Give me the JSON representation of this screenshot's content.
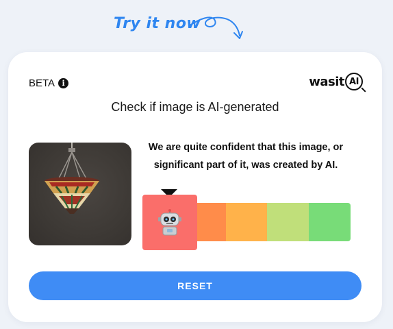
{
  "banner": {
    "text": "Try it now"
  },
  "header": {
    "beta_label": "BETA",
    "logo_was": "was",
    "logo_it": "it",
    "logo_ai": "AI"
  },
  "main": {
    "title": "Check if image is AI-generated",
    "verdict": "We are quite confident that this image, or significant part of it, was created by AI."
  },
  "meter": {
    "segments": [
      "#fa6e6a",
      "#ff8c4a",
      "#ffb24a",
      "#c0df7a",
      "#78dc78"
    ],
    "selected_index": 0,
    "selected_icon": "robot-icon"
  },
  "image": {
    "subject": "stained-glass-pendant-lamp"
  },
  "actions": {
    "reset_label": "RESET"
  },
  "colors": {
    "accent": "#3f8cf5",
    "banner": "#2f86f0"
  }
}
